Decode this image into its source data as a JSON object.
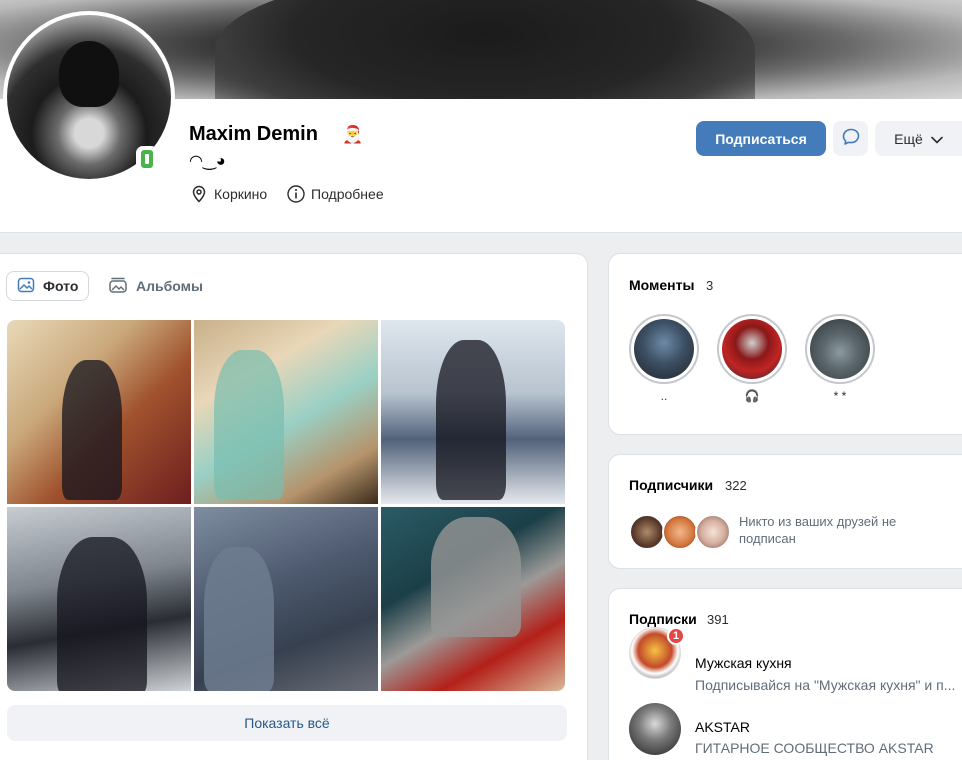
{
  "profile": {
    "name": "Maxim Demin",
    "name_emoji": "🎅",
    "status": "◠‿◕",
    "city": "Коркино",
    "details": "Подробнее"
  },
  "actions": {
    "subscribe": "Подписаться",
    "more": "Ещё"
  },
  "photos": {
    "tabs": [
      {
        "label": "Фото",
        "active": true
      },
      {
        "label": "Альбомы",
        "active": false
      }
    ],
    "show_all": "Показать всё"
  },
  "moments": {
    "title": "Моменты",
    "count": "3",
    "items": [
      {
        "caption": ".."
      },
      {
        "caption": "🎧"
      },
      {
        "caption": "* *"
      }
    ]
  },
  "subscribers": {
    "title": "Подписчики",
    "count": "322",
    "text": "Никто из ваших друзей не подписан"
  },
  "subscriptions": {
    "title": "Подписки",
    "count": "391",
    "items": [
      {
        "name": "Мужская кухня",
        "desc": "Подписывайся на \"Мужская кухня\" и п...",
        "badge": "1"
      },
      {
        "name": "AKSTAR",
        "desc": "ГИТАРНОЕ СООБЩЕСТВО AKSTAR"
      }
    ]
  },
  "colors": {
    "accent": "#447bba",
    "link": "#2a5885",
    "online": "#4bb34b",
    "background": "#edeef0"
  }
}
